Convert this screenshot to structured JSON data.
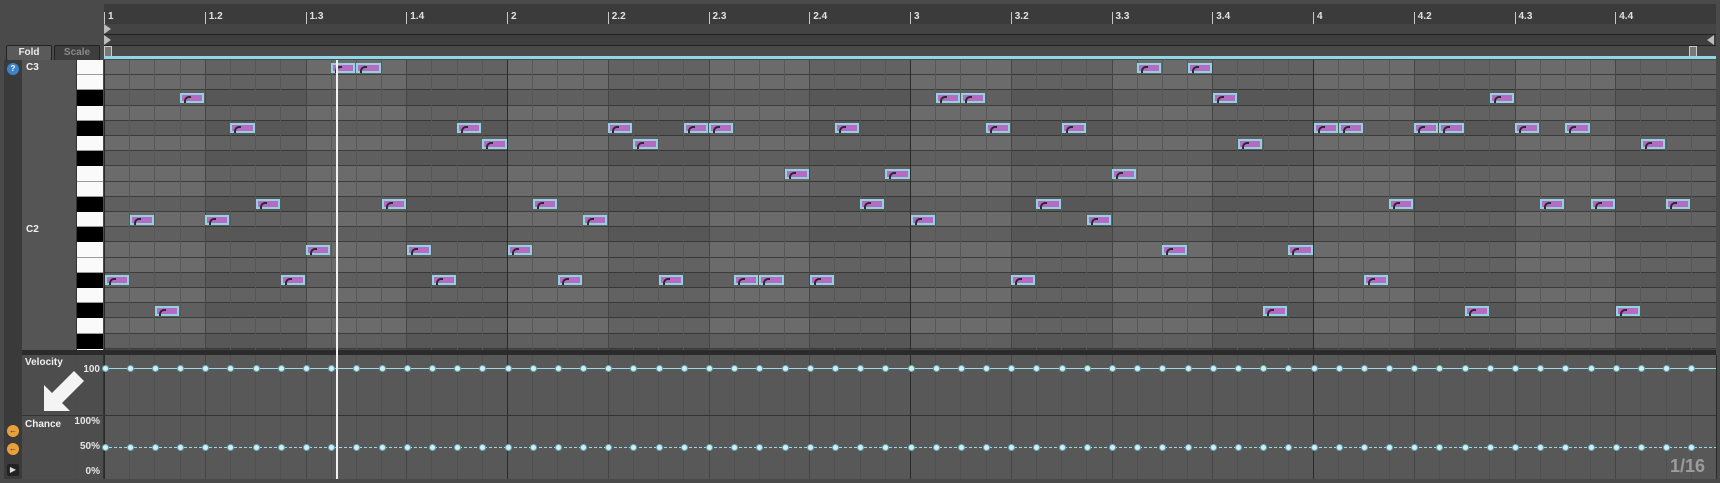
{
  "ruler": {
    "labels": [
      "1",
      "1.2",
      "1.3",
      "1.4",
      "2",
      "2.2",
      "2.3",
      "2.4",
      "3",
      "3.2",
      "3.3",
      "3.4",
      "4",
      "4.2",
      "4.3",
      "4.4"
    ]
  },
  "buttons": {
    "fold": "Fold",
    "scale": "Scale"
  },
  "pitch_labels": {
    "c3": "C3",
    "c2": "C2"
  },
  "lanes": {
    "velocity": {
      "title": "Velocity",
      "value_label": "100"
    },
    "chance": {
      "title": "Chance",
      "top_label": "100%",
      "mid_label": "50%",
      "bottom_label": "0%"
    }
  },
  "grid_label": "1/16",
  "icons": {
    "info": "info-icon",
    "arrow_left_1": "arrow-icon",
    "arrow_left_2": "arrow-icon",
    "play": "play-icon",
    "pointer": "pointer-arrow-icon"
  },
  "colors": {
    "note_fill": "#b86ac2",
    "note_border": "#8fd3e2",
    "loop": "#8fd7e6"
  },
  "notes": [
    {
      "step": 0,
      "row": 14
    },
    {
      "step": 1,
      "row": 10
    },
    {
      "step": 2,
      "row": 16
    },
    {
      "step": 3,
      "row": 2
    },
    {
      "step": 4,
      "row": 10
    },
    {
      "step": 5,
      "row": 4
    },
    {
      "step": 6,
      "row": 9
    },
    {
      "step": 7,
      "row": 14
    },
    {
      "step": 8,
      "row": 12
    },
    {
      "step": 9,
      "row": 0
    },
    {
      "step": 10,
      "row": 0
    },
    {
      "step": 11,
      "row": 9
    },
    {
      "step": 12,
      "row": 12
    },
    {
      "step": 13,
      "row": 14
    },
    {
      "step": 14,
      "row": 4
    },
    {
      "step": 15,
      "row": 5
    },
    {
      "step": 16,
      "row": 12
    },
    {
      "step": 17,
      "row": 9
    },
    {
      "step": 18,
      "row": 14
    },
    {
      "step": 19,
      "row": 10
    },
    {
      "step": 20,
      "row": 4
    },
    {
      "step": 21,
      "row": 5
    },
    {
      "step": 22,
      "row": 14
    },
    {
      "step": 23,
      "row": 4
    },
    {
      "step": 24,
      "row": 4
    },
    {
      "step": 25,
      "row": 14
    },
    {
      "step": 26,
      "row": 14
    },
    {
      "step": 27,
      "row": 7
    },
    {
      "step": 28,
      "row": 14
    },
    {
      "step": 29,
      "row": 4
    },
    {
      "step": 30,
      "row": 9
    },
    {
      "step": 31,
      "row": 7
    },
    {
      "step": 32,
      "row": 10
    },
    {
      "step": 33,
      "row": 2
    },
    {
      "step": 34,
      "row": 2
    },
    {
      "step": 35,
      "row": 4
    },
    {
      "step": 36,
      "row": 14
    },
    {
      "step": 37,
      "row": 9
    },
    {
      "step": 38,
      "row": 4
    },
    {
      "step": 39,
      "row": 10
    },
    {
      "step": 40,
      "row": 7
    },
    {
      "step": 41,
      "row": 0
    },
    {
      "step": 42,
      "row": 12
    },
    {
      "step": 43,
      "row": 0
    },
    {
      "step": 44,
      "row": 2
    },
    {
      "step": 45,
      "row": 5
    },
    {
      "step": 46,
      "row": 16
    },
    {
      "step": 47,
      "row": 12
    },
    {
      "step": 48,
      "row": 4
    },
    {
      "step": 49,
      "row": 4
    },
    {
      "step": 50,
      "row": 14
    },
    {
      "step": 51,
      "row": 9
    },
    {
      "step": 52,
      "row": 4
    },
    {
      "step": 53,
      "row": 4
    },
    {
      "step": 54,
      "row": 16
    },
    {
      "step": 55,
      "row": 2
    },
    {
      "step": 56,
      "row": 4
    },
    {
      "step": 57,
      "row": 9
    },
    {
      "step": 58,
      "row": 4
    },
    {
      "step": 59,
      "row": 9
    },
    {
      "step": 60,
      "row": 16
    },
    {
      "step": 61,
      "row": 5
    },
    {
      "step": 62,
      "row": 9
    }
  ]
}
